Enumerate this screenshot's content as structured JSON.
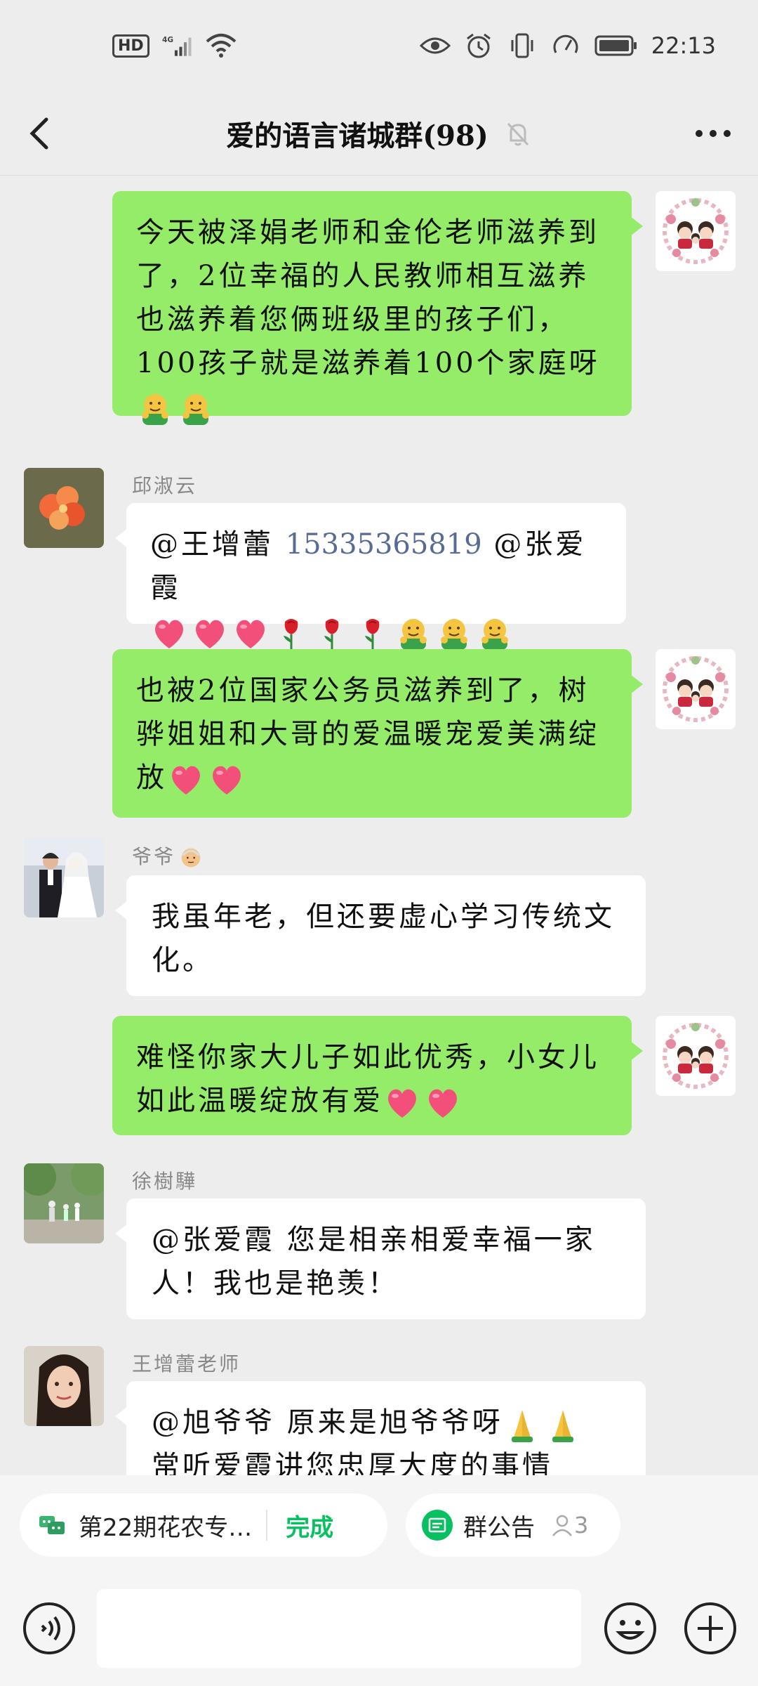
{
  "status_bar": {
    "left_tag": "HD",
    "network": "4G",
    "time": "22:13",
    "icons": [
      "hd-icon",
      "signal-icon",
      "wifi-icon",
      "eye-icon",
      "alarm-icon",
      "vibrate-icon",
      "speedometer-icon",
      "battery-icon"
    ]
  },
  "header": {
    "title": "爱的语言诸城群(98)",
    "icons": [
      "back-icon",
      "mute-bell-icon",
      "more-icon"
    ]
  },
  "messages": [
    {
      "side": "mine",
      "text": "今天被泽娟老师和金伦老师滋养到了，2位幸福的人民教师相互滋养也滋养着您俩班级里的孩子们，100孩子就是滋养着100个家庭呀",
      "emojis": [
        "hug-emoji",
        "hug-emoji"
      ]
    },
    {
      "side": "theirs",
      "sender": "邱淑云",
      "mention1": "@王增蕾",
      "phone": "15335365819",
      "mention2": "@张爱霞",
      "emojis": [
        "heart-emoji",
        "heart-emoji",
        "heart-emoji",
        "rose-emoji",
        "rose-emoji",
        "rose-emoji",
        "hug-emoji",
        "hug-emoji",
        "hug-emoji"
      ]
    },
    {
      "side": "mine",
      "text": "也被2位国家公务员滋养到了，树骅姐姐和大哥的爱温暖宠爱美满绽放",
      "emojis": [
        "heart-emoji",
        "heart-emoji"
      ]
    },
    {
      "side": "theirs",
      "sender": "爷爷",
      "sender_emoji": "old-man-emoji",
      "text": "我虽年老，但还要虚心学习传统文化。"
    },
    {
      "side": "mine",
      "text": "难怪你家大儿子如此优秀，小女儿如此温暖绽放有爱",
      "emojis": [
        "heart-emoji",
        "heart-emoji"
      ]
    },
    {
      "side": "theirs",
      "sender": "徐樹驊",
      "text": "@张爱霞  您是相亲相爱幸福一家人！我也是艳羡！"
    },
    {
      "side": "theirs",
      "sender": "王增蕾老师",
      "text_line1": "@旭爷爷  原来是旭爷爷呀",
      "text_line2": "常听爱霞讲您忠厚大度的事情",
      "emojis": [
        "pray-emoji",
        "pray-emoji"
      ]
    }
  ],
  "quick_bar": {
    "task_label": "第22期花农专…",
    "task_action": "完成",
    "notice_label": "群公告",
    "notice_count": "3"
  },
  "input_bar": {
    "icons": [
      "voice-icon",
      "emoji-icon",
      "plus-icon"
    ],
    "value": ""
  },
  "colors": {
    "my_bubble": "#95ec69",
    "their_bubble": "#ffffff",
    "background": "#ededed",
    "accent_green": "#07c160",
    "link_blue": "#576b95"
  }
}
